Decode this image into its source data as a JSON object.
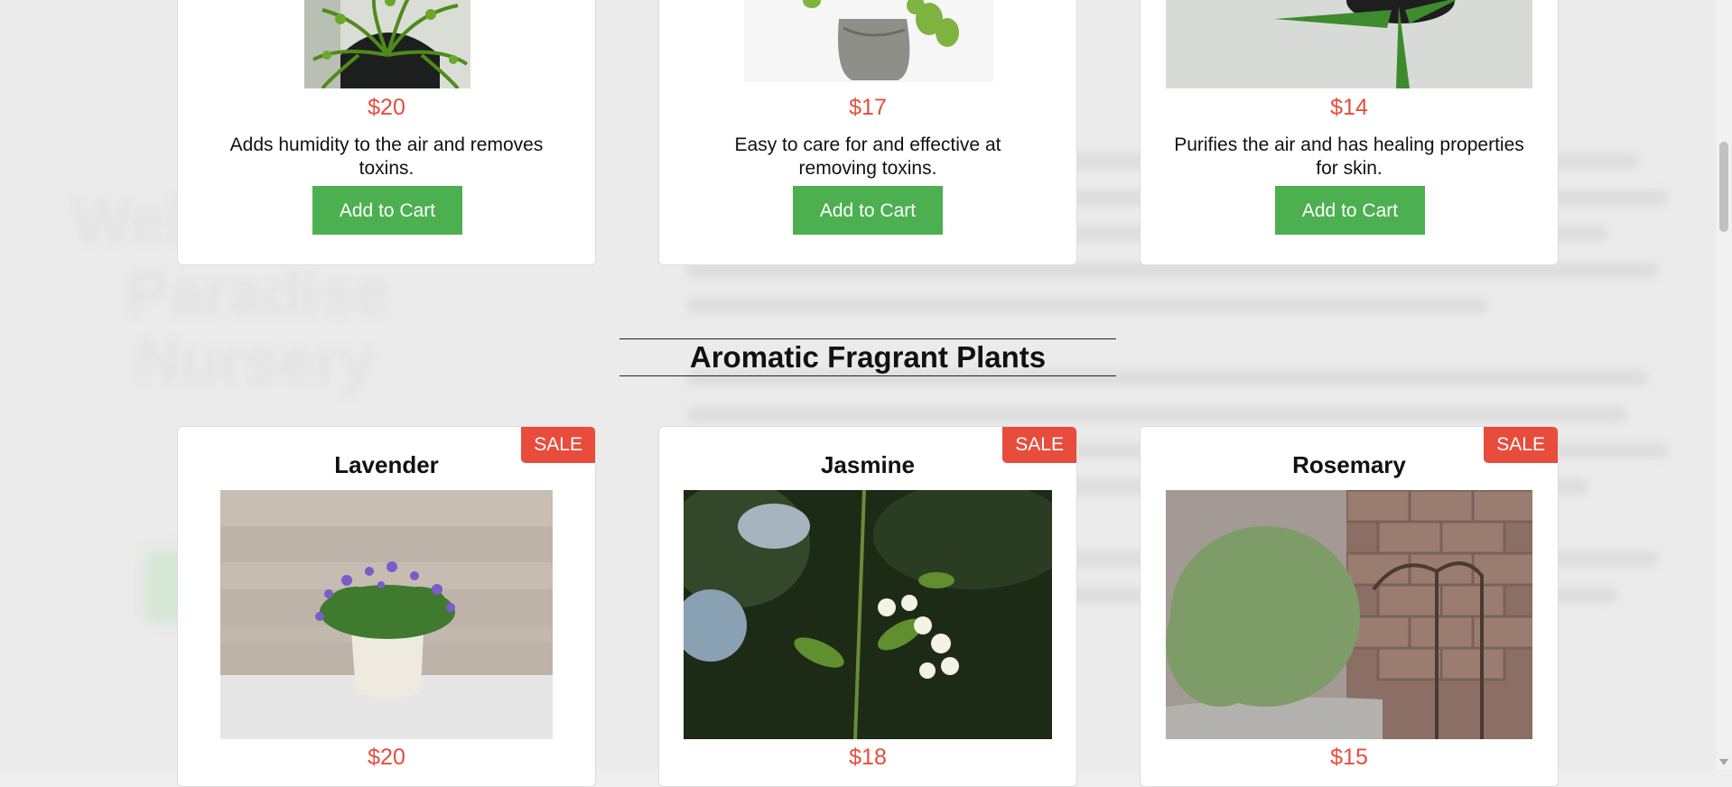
{
  "background": {
    "hero_lines": [
      "Wel",
      "Paradise",
      "Nursery"
    ]
  },
  "top_products": [
    {
      "price": "$20",
      "description": "Adds humidity to the air and removes toxins.",
      "button": "Add to Cart"
    },
    {
      "price": "$17",
      "description": "Easy to care for and effective at removing toxins.",
      "button": "Add to Cart"
    },
    {
      "price": "$14",
      "description": "Purifies the air and has healing properties for skin.",
      "button": "Add to Cart"
    }
  ],
  "section": {
    "title": "Aromatic Fragrant Plants"
  },
  "fragrant_products": [
    {
      "name": "Lavender",
      "badge": "SALE",
      "price": "$20"
    },
    {
      "name": "Jasmine",
      "badge": "SALE",
      "price": "$18"
    },
    {
      "name": "Rosemary",
      "badge": "SALE",
      "price": "$15"
    }
  ],
  "colors": {
    "price": "#e74c3c",
    "button": "#4caf50",
    "sale_badge": "#e74c3c"
  }
}
